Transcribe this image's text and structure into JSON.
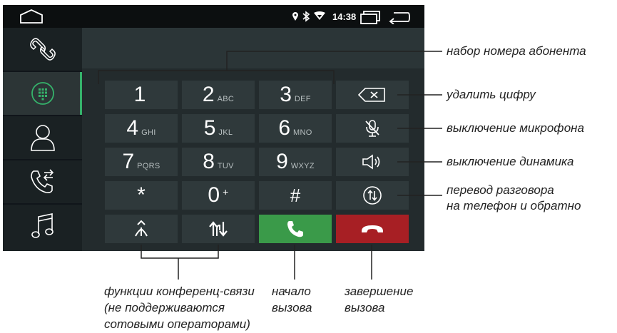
{
  "statusbar": {
    "time": "14:38"
  },
  "keypad": [
    {
      "num": "1",
      "letters": ""
    },
    {
      "num": "2",
      "letters": "ABC"
    },
    {
      "num": "3",
      "letters": "DEF"
    },
    {
      "num": "4",
      "letters": "GHI"
    },
    {
      "num": "5",
      "letters": "JKL"
    },
    {
      "num": "6",
      "letters": "MNO"
    },
    {
      "num": "7",
      "letters": "PQRS"
    },
    {
      "num": "8",
      "letters": "TUV"
    },
    {
      "num": "9",
      "letters": "WXYZ"
    },
    {
      "num": "*",
      "letters": ""
    },
    {
      "num": "0",
      "letters": "+"
    },
    {
      "num": "#",
      "letters": ""
    }
  ],
  "annotations": {
    "dial_number": "набор номера абонента",
    "delete_digit": "удалить цифру",
    "mic_off": "выключение микрофона",
    "speaker_off": "выключение динамика",
    "transfer_line1": "перевод разговора",
    "transfer_line2": "на телефон и обратно",
    "conference_line1": "функции конференц-связи",
    "conference_line2": "(не поддерживаются",
    "conference_line3": "сотовыми операторами)",
    "call_start_line1": "начало",
    "call_start_line2": "вызова",
    "call_end_line1": "завершение",
    "call_end_line2": "вызова"
  },
  "colors": {
    "accent": "#35b36b",
    "call": "#3a9a49",
    "hangup": "#a71f24"
  },
  "icons": {
    "sidebar": [
      "link-icon",
      "dialpad-icon",
      "contact-icon",
      "call-log-icon",
      "music-icon"
    ],
    "function_keys": [
      "backspace-icon",
      "mic-off-icon",
      "speaker-icon",
      "transfer-icon"
    ]
  }
}
